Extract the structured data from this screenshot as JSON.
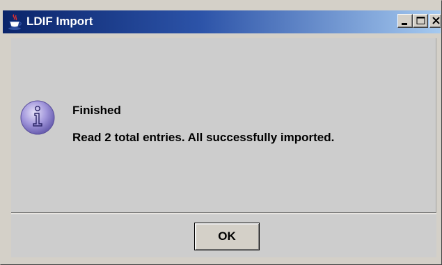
{
  "window": {
    "title": "LDIF Import",
    "title_icon": "java-coffee-cup-icon",
    "controls": [
      "minimize-icon",
      "maximize-icon",
      "close-icon"
    ]
  },
  "message": {
    "icon": "information-icon",
    "title": "Finished",
    "body": "Read 2 total entries. All successfully imported."
  },
  "buttons": {
    "ok_label": "OK"
  },
  "colors": {
    "titlebar_start": "#0a246a",
    "titlebar_end": "#a6caf0",
    "dialog_background": "#cdcdcd",
    "info_icon": "#9b8fd6"
  }
}
